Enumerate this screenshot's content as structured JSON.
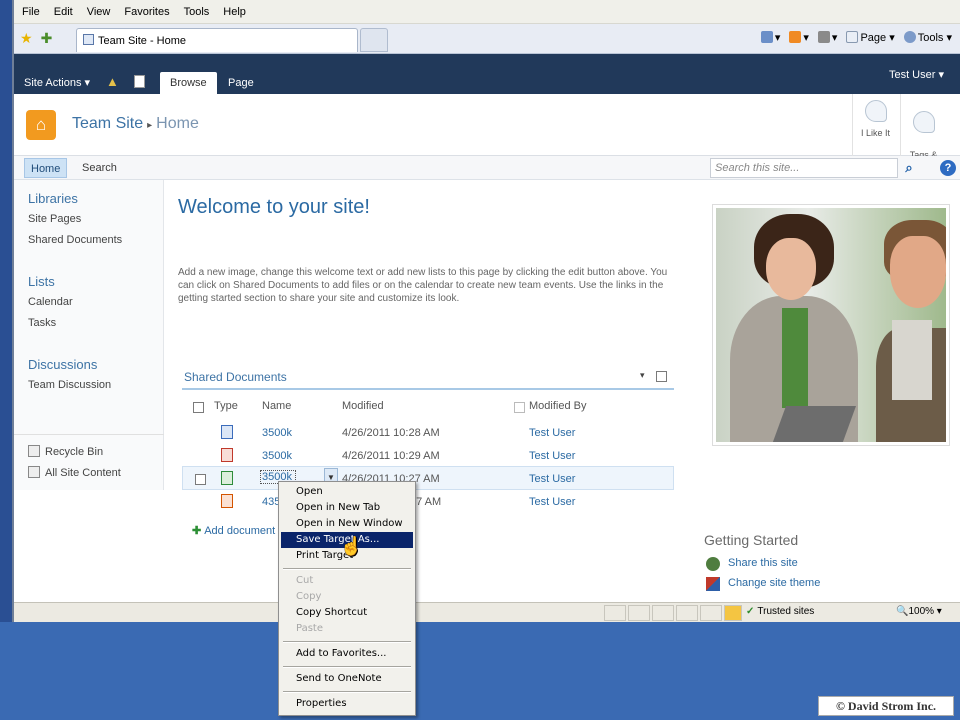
{
  "ie": {
    "menu": [
      "File",
      "Edit",
      "View",
      "Favorites",
      "Tools",
      "Help"
    ],
    "tab_title": "Team Site - Home",
    "command_bar": [
      "Page",
      "Tools"
    ]
  },
  "ribbon": {
    "site_actions": "Site Actions ▾",
    "tabs": [
      "Browse",
      "Page"
    ],
    "user": "Test User ▾"
  },
  "title_area": {
    "site": "Team Site",
    "separator": "▸",
    "page": "Home",
    "i_like_it": "I Like It",
    "tags_notes": "Tags &\nNotes"
  },
  "top_nav": {
    "items": [
      "Home",
      "Search"
    ],
    "search_placeholder": "Search this site..."
  },
  "quick_launch": {
    "libraries": "Libraries",
    "library_items": [
      "Site Pages",
      "Shared Documents"
    ],
    "lists": "Lists",
    "list_items": [
      "Calendar",
      "Tasks"
    ],
    "discussions": "Discussions",
    "discussion_items": [
      "Team Discussion"
    ],
    "recycle_bin": "Recycle Bin",
    "all_site_content": "All Site Content"
  },
  "content": {
    "welcome": "Welcome to your site!",
    "intro": "Add a new image, change this welcome text or add new lists to this page by clicking the edit button above. You can click on Shared Documents to add files or on the calendar to create new team events. Use the links in the getting started section to share your site and customize its look."
  },
  "doclib": {
    "title": "Shared Documents",
    "columns": [
      "Type",
      "Name",
      "Modified",
      "Modified By"
    ],
    "rows": [
      {
        "type": "word",
        "name": "3500k",
        "modified": "4/26/2011 10:28 AM",
        "by": "Test User"
      },
      {
        "type": "pdf",
        "name": "3500k",
        "modified": "4/26/2011 10:29 AM",
        "by": "Test User"
      },
      {
        "type": "xls",
        "name": "3500k",
        "modified": "4/26/2011 10:27 AM",
        "by": "Test User"
      },
      {
        "type": "ppt",
        "name": "435",
        "modified": "27 AM",
        "by": "Test User"
      }
    ],
    "add_document": "Add document"
  },
  "getting_started": {
    "title": "Getting Started",
    "items": [
      "Share this site",
      "Change site theme"
    ]
  },
  "status_bar": {
    "zone": "Trusted sites",
    "zoom": "100%"
  },
  "context_menu": {
    "items": [
      {
        "label": "Open",
        "state": "normal"
      },
      {
        "label": "Open in New Tab",
        "state": "normal"
      },
      {
        "label": "Open in New Window",
        "state": "normal"
      },
      {
        "label": "Save Target As...",
        "state": "selected"
      },
      {
        "label": "Print Target",
        "state": "normal"
      },
      {
        "label": "Cut",
        "state": "disabled"
      },
      {
        "label": "Copy",
        "state": "disabled"
      },
      {
        "label": "Copy Shortcut",
        "state": "normal"
      },
      {
        "label": "Paste",
        "state": "disabled"
      },
      {
        "label": "Add to Favorites...",
        "state": "normal"
      },
      {
        "label": "Send to OneNote",
        "state": "normal"
      },
      {
        "label": "Properties",
        "state": "normal"
      }
    ]
  },
  "watermark": "© David Strom Inc.",
  "colors": {
    "ribbon": "#21395a",
    "link": "#2b6aa3",
    "menu_highlight": "#0a246a",
    "logo": "#f29a1f"
  }
}
